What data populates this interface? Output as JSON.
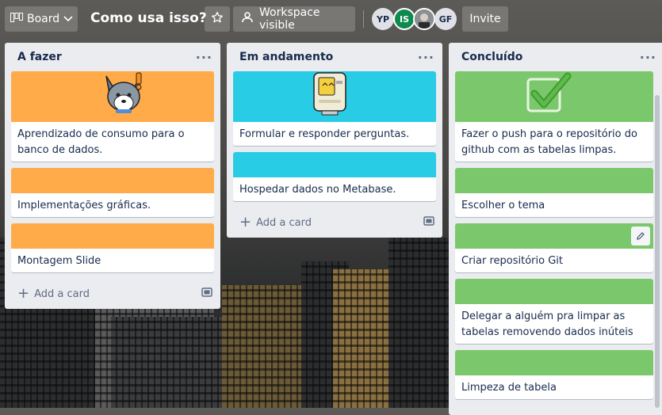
{
  "header": {
    "board_view_label": "Board",
    "board_title": "Como usa isso?",
    "workspace_label": "Workspace visible",
    "invite_label": "Invite",
    "members": [
      {
        "initials": "YP"
      },
      {
        "initials": "IS"
      },
      {
        "initials": ""
      },
      {
        "initials": "GF"
      }
    ]
  },
  "lists": [
    {
      "title": "A fazer",
      "menu": "···",
      "add_label": "Add a card",
      "cards": [
        {
          "text": "Aprendizado de consumo para o banco de dados.",
          "cover_color": "#ffab4a",
          "cover_icon": "husky-sticker-icon"
        },
        {
          "text": "Implementações gráficas.",
          "cover_color": "#ffab4a"
        },
        {
          "text": "Montagem Slide",
          "cover_color": "#ffab4a"
        }
      ]
    },
    {
      "title": "Em andamento",
      "menu": "···",
      "add_label": "Add a card",
      "cards": [
        {
          "text": "Formular e responder perguntas.",
          "cover_color": "#29cce5",
          "cover_icon": "computer-sticker-icon"
        },
        {
          "text": "Hospedar dados no Metabase.",
          "cover_color": "#29cce5"
        }
      ]
    },
    {
      "title": "Concluído",
      "menu": "···",
      "cards": [
        {
          "text": "Fazer o push para o repositório do github com as tabelas limpas.",
          "cover_color": "#7bc86c",
          "cover_icon": "check-sticker-icon"
        },
        {
          "text": "Escolher o tema",
          "cover_color": "#7bc86c"
        },
        {
          "text": "Criar repositório Git",
          "cover_color": "#7bc86c"
        },
        {
          "text": "Delegar a alguém pra limpar as tabelas removendo dados inúteis",
          "cover_color": "#7bc86c"
        },
        {
          "text": "Limpeza de tabela",
          "cover_color": "#7bc86c"
        }
      ]
    }
  ]
}
